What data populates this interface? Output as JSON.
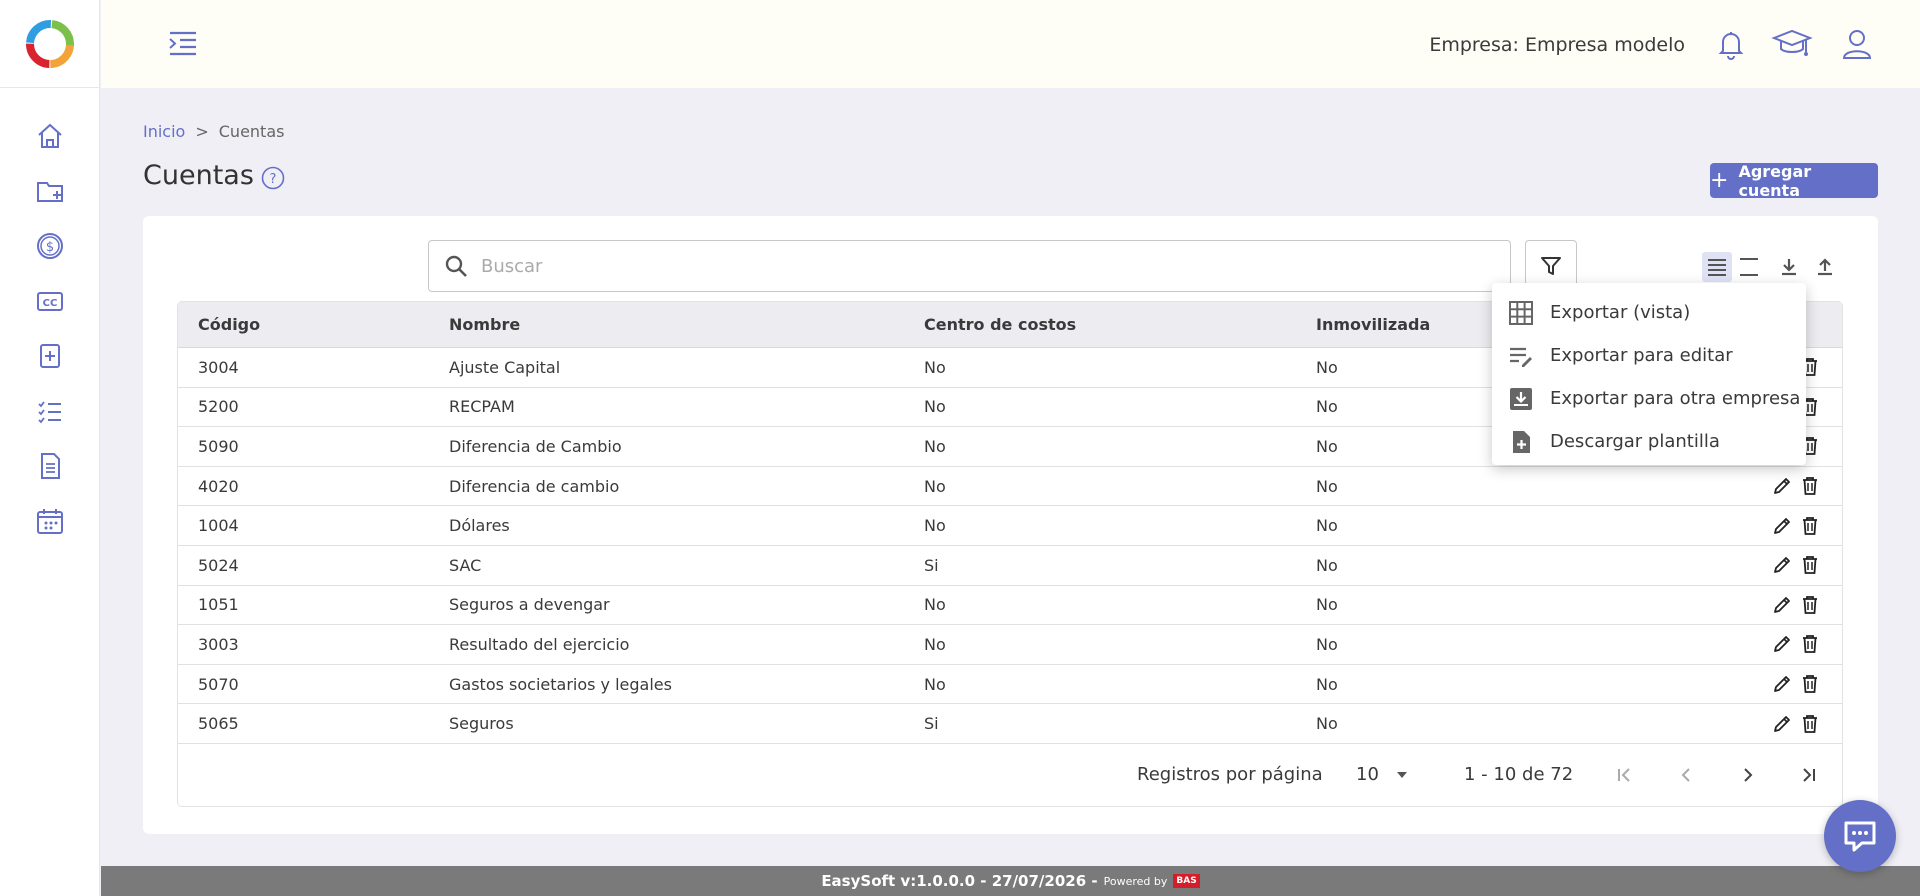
{
  "header": {
    "company_label": "Empresa: Empresa modelo"
  },
  "breadcrumb": {
    "home": "Inicio",
    "separator": ">",
    "current": "Cuentas"
  },
  "page": {
    "title": "Cuentas",
    "add_button": "Agregar cuenta"
  },
  "search": {
    "placeholder": "Buscar",
    "value": ""
  },
  "table": {
    "columns": [
      "Código",
      "Nombre",
      "Centro de costos",
      "Inmovilizada"
    ],
    "rows": [
      {
        "codigo": "3004",
        "nombre": "Ajuste Capital",
        "centro": "No",
        "inmovilizada": "No"
      },
      {
        "codigo": "5200",
        "nombre": "RECPAM",
        "centro": "No",
        "inmovilizada": "No"
      },
      {
        "codigo": "5090",
        "nombre": "Diferencia de Cambio",
        "centro": "No",
        "inmovilizada": "No"
      },
      {
        "codigo": "4020",
        "nombre": "Diferencia de cambio",
        "centro": "No",
        "inmovilizada": "No"
      },
      {
        "codigo": "1004",
        "nombre": "Dólares",
        "centro": "No",
        "inmovilizada": "No"
      },
      {
        "codigo": "5024",
        "nombre": "SAC",
        "centro": "Si",
        "inmovilizada": "No"
      },
      {
        "codigo": "1051",
        "nombre": "Seguros a devengar",
        "centro": "No",
        "inmovilizada": "No"
      },
      {
        "codigo": "3003",
        "nombre": "Resultado del ejercicio",
        "centro": "No",
        "inmovilizada": "No"
      },
      {
        "codigo": "5070",
        "nombre": "Gastos societarios y legales",
        "centro": "No",
        "inmovilizada": "No"
      },
      {
        "codigo": "5065",
        "nombre": "Seguros",
        "centro": "Si",
        "inmovilizada": "No"
      }
    ]
  },
  "pager": {
    "per_page_label": "Registros por página",
    "per_page_value": "10",
    "range": "1 - 10 de 72"
  },
  "export_menu": {
    "items": [
      "Exportar (vista)",
      "Exportar para editar",
      "Exportar para otra empresa",
      "Descargar plantilla"
    ]
  },
  "footer": {
    "version": "EasySoft v:1.0.0.0 - 27/07/2026 -",
    "powered": "Powered by",
    "brand": "BAS"
  },
  "colors": {
    "accent": "#6470c8",
    "header_bg": "#fefdf6",
    "page_bg": "#efeff5"
  }
}
